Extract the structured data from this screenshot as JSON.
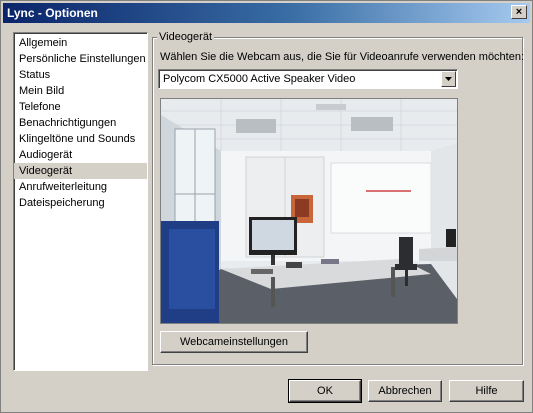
{
  "window": {
    "title": "Lync - Optionen",
    "close_glyph": "×"
  },
  "nav": {
    "items": [
      {
        "label": "Allgemein"
      },
      {
        "label": "Persönliche Einstellungen"
      },
      {
        "label": "Status"
      },
      {
        "label": "Mein Bild"
      },
      {
        "label": "Telefone"
      },
      {
        "label": "Benachrichtigungen"
      },
      {
        "label": "Klingeltöne und Sounds"
      },
      {
        "label": "Audiogerät"
      },
      {
        "label": "Videogerät",
        "selected": true
      },
      {
        "label": "Anrufweiterleitung"
      },
      {
        "label": "Dateispeicherung"
      }
    ]
  },
  "video": {
    "group_title": "Videogerät",
    "instruction": "Wählen Sie die Webcam aus, die Sie für Videoanrufe verwenden möchten:",
    "camera_select": {
      "value": "Polycom CX5000 Active Speaker Video"
    },
    "settings_button": "Webcameinstellungen"
  },
  "footer": {
    "ok": "OK",
    "cancel": "Abbrechen",
    "help": "Hilfe"
  },
  "colors": {
    "dialog_bg": "#d4d0c8",
    "title_start": "#0a246a",
    "title_end": "#a6caf0"
  }
}
